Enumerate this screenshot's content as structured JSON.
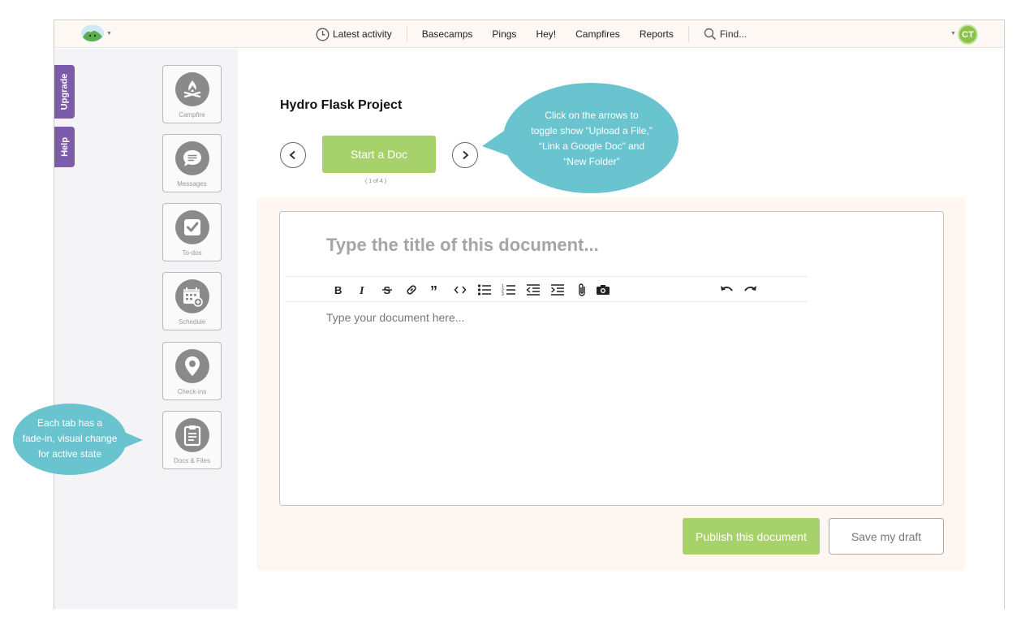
{
  "header": {
    "nav": {
      "latest_activity": "Latest activity",
      "basecamps": "Basecamps",
      "pings": "Pings",
      "hey": "Hey!",
      "campfires": "Campfires",
      "reports": "Reports",
      "find": "Find..."
    },
    "avatar_initials": "CT"
  },
  "side_tabs": {
    "upgrade": "Upgrade",
    "help": "Help"
  },
  "tools": [
    {
      "label": "Campfire",
      "icon": "campfire-icon"
    },
    {
      "label": "Messages",
      "icon": "chat-bubble-icon"
    },
    {
      "label": "To-dos",
      "icon": "checkbox-icon"
    },
    {
      "label": "Schedule",
      "icon": "calendar-icon"
    },
    {
      "label": "Check-ins",
      "icon": "map-pin-icon"
    },
    {
      "label": "Docs & Files",
      "icon": "clipboard-icon"
    }
  ],
  "project": {
    "title": "Hydro Flask Project",
    "start_doc": "Start a Doc",
    "pager": "( 1 of 4 )"
  },
  "editor": {
    "title_placeholder": "Type the title of this document...",
    "body_placeholder": "Type your document here...",
    "publish_label": "Publish this document",
    "draft_label": "Save my draft"
  },
  "callouts": {
    "arrows_lines": [
      "Click on the arrows to",
      "toggle show “Upload a File,”",
      "“Link a Google Doc” and",
      "“New Folder”"
    ],
    "tabs_lines": [
      "Each tab has a",
      "fade-in, visual change",
      "for active state"
    ]
  },
  "colors": {
    "brand_green": "#a7d26b",
    "upgrade_purple": "#7d5bab",
    "callout_teal": "#6ac4cf",
    "avatar_green": "#8bc34a"
  }
}
